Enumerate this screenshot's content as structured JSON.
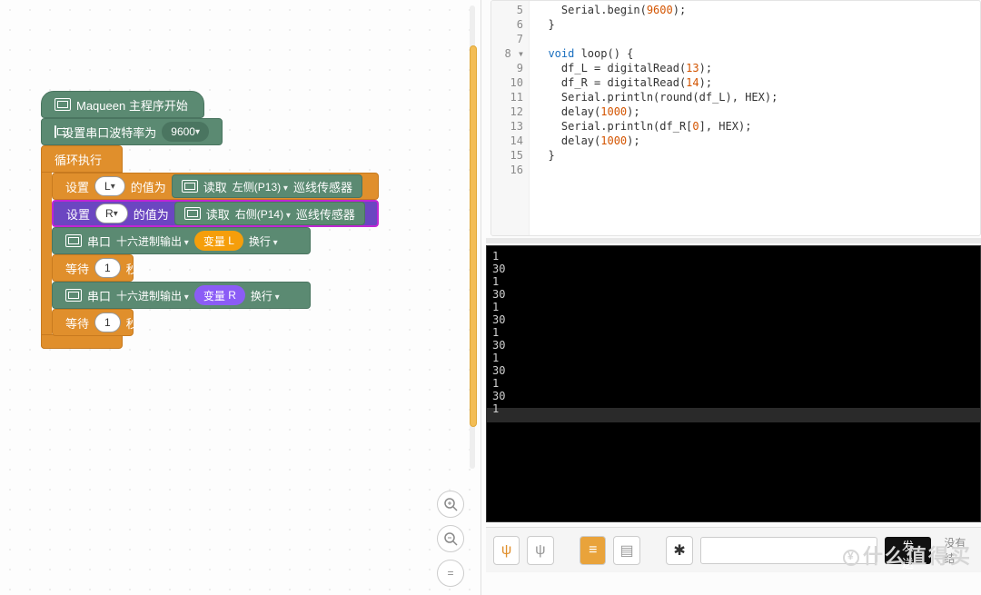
{
  "blocks": {
    "hat": "Maqueen 主程序开始",
    "baud_label": "设置串口波特率为",
    "baud_value": "9600",
    "loop_label": "循环执行",
    "set_label": "设置",
    "var_L": "L",
    "var_R": "R",
    "value_label": "的值为",
    "read_label": "读取",
    "left_pin": "左侧(P13)",
    "right_pin": "右侧(P14)",
    "sensor_label": "巡线传感器",
    "serial_label": "串口",
    "hex_label": "十六进制输出",
    "var_prefix": "变量",
    "newline_label": "换行",
    "wait_label": "等待",
    "wait_value": "1",
    "wait_unit": "秒"
  },
  "code": {
    "lines": [
      {
        "n": "5",
        "fold": "",
        "html": "    Serial.begin(<span class='num'>9600</span>);"
      },
      {
        "n": "6",
        "fold": "",
        "html": "  }"
      },
      {
        "n": "7",
        "fold": "",
        "html": ""
      },
      {
        "n": "8",
        "fold": "▾",
        "html": "  <span class='kw'>void</span> loop() {"
      },
      {
        "n": "9",
        "fold": "",
        "html": "    df_L = digitalRead(<span class='num'>13</span>);"
      },
      {
        "n": "10",
        "fold": "",
        "html": "    df_R = digitalRead(<span class='num'>14</span>);"
      },
      {
        "n": "11",
        "fold": "",
        "html": "    Serial.println(round(df_L), HEX);"
      },
      {
        "n": "12",
        "fold": "",
        "html": "    delay(<span class='num'>1000</span>);"
      },
      {
        "n": "13",
        "fold": "",
        "html": "    Serial.println(df_R[<span class='num'>0</span>], HEX);"
      },
      {
        "n": "14",
        "fold": "",
        "html": "    delay(<span class='num'>1000</span>);"
      },
      {
        "n": "15",
        "fold": "",
        "html": "  }"
      },
      {
        "n": "16",
        "fold": "",
        "html": ""
      }
    ]
  },
  "serial_output": [
    "1",
    "30",
    "1",
    "30",
    "1",
    "30",
    "1",
    "30",
    "1",
    "30",
    "1",
    "30",
    "1"
  ],
  "bottombar": {
    "send_label": "发送",
    "right_label": "没有结",
    "input_placeholder": ""
  },
  "watermark": "什么值得买",
  "zoom": {
    "in": "+",
    "out": "−",
    "reset": "="
  }
}
